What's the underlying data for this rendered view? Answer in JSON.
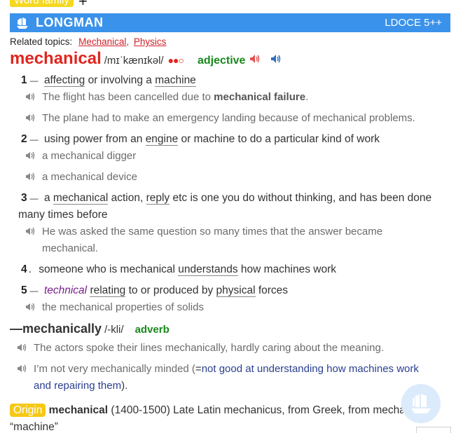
{
  "word_family_tab": "Word family",
  "banner": {
    "title": "LONGMAN",
    "edition": "LDOCE 5++"
  },
  "related_topics": {
    "label": "Related topics:",
    "items": [
      "Mechanical",
      "Physics"
    ],
    "separator": ","
  },
  "entry": {
    "headword": "mechanical",
    "pronunciation": "/mɪˈkænɪkəl/",
    "frequency": "●●○",
    "pos": "adjective",
    "icons": {
      "brit_audio": "speaker-red-icon",
      "amer_audio": "speaker-blue-icon",
      "example_audio": "speaker-gray-icon"
    },
    "colors": {
      "headword": "#e0261e",
      "pos": "#18891c",
      "banner": "#3a92ea",
      "origin": "#f5c816"
    }
  },
  "senses": [
    {
      "num": "1",
      "def_parts": [
        "affecting",
        " or involving a ",
        "machine"
      ],
      "examples": [
        {
          "parts": [
            "The flight has been cancelled due to ",
            "mechanical failure",
            "."
          ]
        },
        {
          "parts": [
            "The plane had to make an emergency landing because of mechanical problems."
          ]
        }
      ]
    },
    {
      "num": "2",
      "def_parts": [
        "using power from an ",
        "engine",
        " or machine to do a particular kind of work"
      ],
      "examples": [
        {
          "parts": [
            "a mechanical digger"
          ]
        },
        {
          "parts": [
            "a mechanical device"
          ]
        }
      ]
    },
    {
      "num": "3",
      "def_parts": [
        "a ",
        "mechanical",
        " action, ",
        "reply",
        " etc is one you do without thinking, and has been done",
        "many times before"
      ],
      "examples": [
        {
          "parts": [
            "He was asked the same question so many times that the answer became",
            "mechanical."
          ]
        }
      ]
    },
    {
      "num": "4",
      "def_parts": [
        "someone who is mechanical ",
        "understands",
        " how machines work"
      ],
      "examples": []
    },
    {
      "num": "5",
      "activator": "technical",
      "def_parts": [
        " ",
        "relating",
        " to or produced by ",
        "physical",
        " forces"
      ],
      "examples": [
        {
          "parts": [
            "the mechanical properties of solids"
          ]
        }
      ]
    }
  ],
  "runon": {
    "dash": "—",
    "word": "mechanically",
    "pronunciation": "/-kli/",
    "pos": "adverb",
    "examples": [
      {
        "text": "The actors spoke their lines mechanically, hardly caring about the meaning."
      },
      {
        "text": "I’m not very mechanically minded (",
        "gloss_eq": "=",
        "gloss": "not good at understanding how machines work",
        "gloss_line2": "and repairing them",
        "tail": ")."
      }
    ]
  },
  "origin": {
    "label": "Origin",
    "word": "mechanical",
    "text": " (1400-1500) Late Latin mechanicus, from Greek, from mechane",
    "line2": "“machine”"
  }
}
